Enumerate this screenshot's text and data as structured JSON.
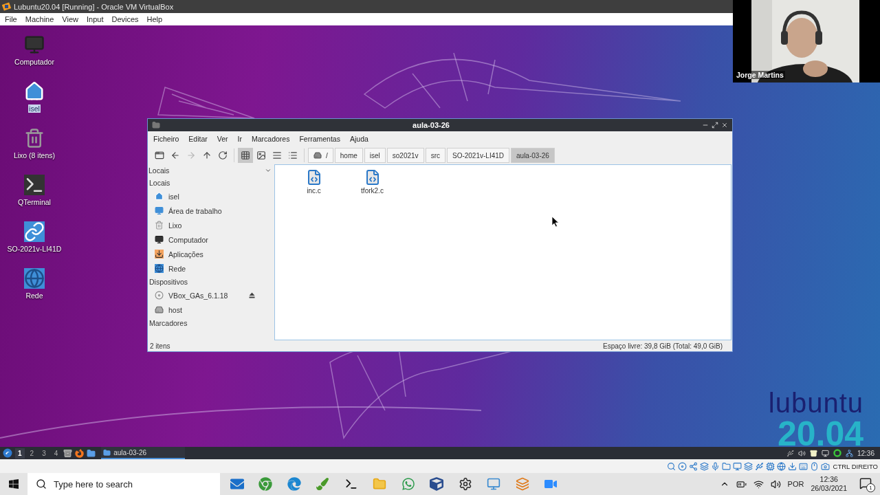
{
  "vbox": {
    "title": "Lubuntu20.04 [Running] - Oracle VM VirtualBox",
    "menu": [
      "File",
      "Machine",
      "View",
      "Input",
      "Devices",
      "Help"
    ],
    "host_key": "CTRL DIREITO"
  },
  "webcam": {
    "name": "Jorge Martins"
  },
  "desktop_icons": [
    {
      "label": "Computador",
      "kind": "computer",
      "selected": false
    },
    {
      "label": "isel",
      "kind": "home",
      "selected": true
    },
    {
      "label": "Lixo (8 itens)",
      "kind": "trash",
      "selected": false
    },
    {
      "label": "QTerminal",
      "kind": "terminal",
      "selected": false
    },
    {
      "label": "SO-2021v-LI41D",
      "kind": "link",
      "selected": false
    },
    {
      "label": "Rede",
      "kind": "network",
      "selected": false
    }
  ],
  "wallpaper": {
    "brand": "lubuntu",
    "version": "20.04"
  },
  "file_manager": {
    "title": "aula-03-26",
    "menu": [
      "Ficheiro",
      "Editar",
      "Ver",
      "Ir",
      "Marcadores",
      "Ferramentas",
      "Ajuda"
    ],
    "nav_buttons": [
      {
        "kind": "new-tab",
        "disabled": false
      },
      {
        "kind": "back",
        "disabled": false
      },
      {
        "kind": "forward",
        "disabled": true
      },
      {
        "kind": "up",
        "disabled": false
      },
      {
        "kind": "reload",
        "disabled": false
      }
    ],
    "view_modes": [
      {
        "kind": "icons",
        "selected": true
      },
      {
        "kind": "thumbnails",
        "selected": false
      },
      {
        "kind": "compact",
        "selected": false
      },
      {
        "kind": "details",
        "selected": false
      }
    ],
    "path": [
      {
        "label": "/",
        "kind": "root",
        "selected": false
      },
      {
        "label": "home",
        "kind": "dir",
        "selected": false
      },
      {
        "label": "isel",
        "kind": "dir",
        "selected": false
      },
      {
        "label": "so2021v",
        "kind": "dir",
        "selected": false
      },
      {
        "label": "src",
        "kind": "dir",
        "selected": false
      },
      {
        "label": "SO-2021v-LI41D",
        "kind": "dir",
        "selected": false
      },
      {
        "label": "aula-03-26",
        "kind": "dir",
        "selected": true
      }
    ],
    "sidebar": {
      "selector": "Locais",
      "sections": [
        {
          "title": "Locais",
          "items": [
            {
              "label": "isel",
              "kind": "home"
            },
            {
              "label": "Área de trabalho",
              "kind": "desktop"
            },
            {
              "label": "Lixo",
              "kind": "trash"
            },
            {
              "label": "Computador",
              "kind": "computer"
            },
            {
              "label": "Aplicações",
              "kind": "apps"
            },
            {
              "label": "Rede",
              "kind": "network"
            }
          ]
        },
        {
          "title": "Dispositivos",
          "items": [
            {
              "label": "VBox_GAs_6.1.18",
              "kind": "disc",
              "eject": true
            },
            {
              "label": "host",
              "kind": "drive",
              "eject": false
            }
          ]
        },
        {
          "title": "Marcadores"
        }
      ]
    },
    "files": [
      {
        "name": "inc.c",
        "kind": "c-source"
      },
      {
        "name": "tfork2.c",
        "kind": "c-source"
      }
    ],
    "status": {
      "count": "2 itens",
      "free_space": "Espaço livre: 39,8 GiB (Total: 49,0 GiB)"
    }
  },
  "panel": {
    "workspaces": [
      {
        "label": "1",
        "selected": true
      },
      {
        "label": "2",
        "selected": false
      },
      {
        "label": "3",
        "selected": false
      },
      {
        "label": "4",
        "selected": false
      }
    ],
    "tasks": [
      {
        "label": "aula-03-26",
        "selected": true
      }
    ],
    "clock": "12:36"
  },
  "taskbar": {
    "search": {
      "placeholder": "Type here to search"
    },
    "language": "POR",
    "time": "12:36",
    "date": "26/03/2021",
    "notifications": "1"
  }
}
